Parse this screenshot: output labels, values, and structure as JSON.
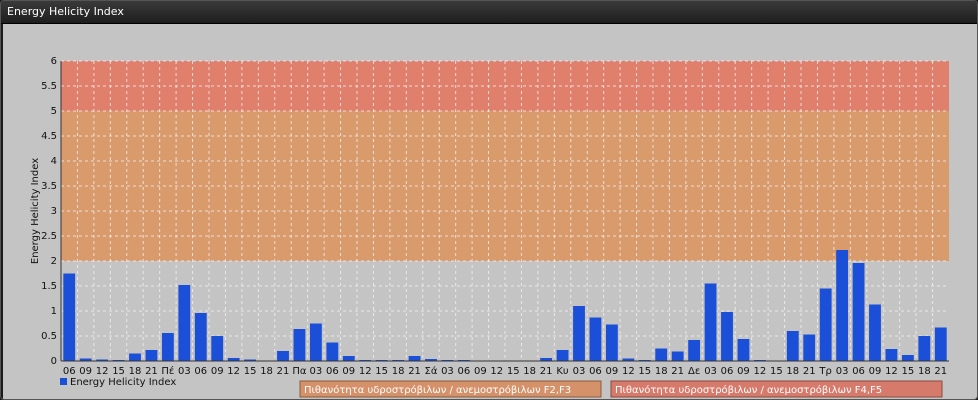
{
  "window": {
    "title": "Energy Helicity Index"
  },
  "chart_data": {
    "type": "bar",
    "ylabel": "Energy Helicity Index",
    "ylim": [
      0,
      6
    ],
    "yticks": [
      "0",
      "0.5",
      "1",
      "1.5",
      "2",
      "2.5",
      "3",
      "3.5",
      "4",
      "4.5",
      "5",
      "5.5",
      "6"
    ],
    "grid": true,
    "bands": [
      {
        "from": 2,
        "to": 5,
        "color": "#d99a6c"
      },
      {
        "from": 5,
        "to": 6,
        "color": "#e07f6c"
      }
    ],
    "categories": [
      "06",
      "09",
      "12",
      "15",
      "18",
      "21",
      "Πέ",
      "03",
      "06",
      "09",
      "12",
      "15",
      "18",
      "21",
      "Πα",
      "03",
      "06",
      "09",
      "12",
      "15",
      "18",
      "21",
      "Σά",
      "03",
      "06",
      "09",
      "12",
      "15",
      "18",
      "21",
      "Κυ",
      "03",
      "06",
      "09",
      "12",
      "15",
      "18",
      "21",
      "Δε",
      "03",
      "06",
      "09",
      "12",
      "15",
      "18",
      "21",
      "Τρ",
      "03",
      "06",
      "09",
      "12",
      "15",
      "18",
      "21"
    ],
    "series": [
      {
        "name": "Energy Helicity Index",
        "color": "#1c4fd8",
        "values": [
          1.75,
          0.05,
          0.03,
          0.02,
          0.15,
          0.22,
          0.56,
          1.52,
          0.96,
          0.5,
          0.06,
          0.03,
          0.01,
          0.2,
          0.64,
          0.75,
          0.37,
          0.1,
          0.02,
          0.02,
          0.02,
          0.1,
          0.04,
          0.02,
          0.02,
          0.01,
          0.01,
          0.01,
          0.01,
          0.06,
          0.22,
          1.1,
          0.87,
          0.73,
          0.05,
          0.02,
          0.25,
          0.19,
          0.42,
          1.55,
          0.98,
          0.44,
          0.02,
          0.01,
          0.6,
          0.53,
          1.45,
          2.22,
          1.96,
          1.13,
          0.24,
          0.12,
          0.5,
          0.67
        ]
      }
    ],
    "legend": {
      "position": "bottom-left",
      "label": "Energy Helicity Index"
    },
    "band_legend": [
      {
        "label": "Πιθανότητα υδροστρόβιλων / ανεμοστρόβιλων F2,F3",
        "color": "#d4916a"
      },
      {
        "label": "Πιθανότητα υδροστρόβιλων / ανεμοστρόβιλων F4,F5",
        "color": "#d67a6c"
      }
    ]
  }
}
